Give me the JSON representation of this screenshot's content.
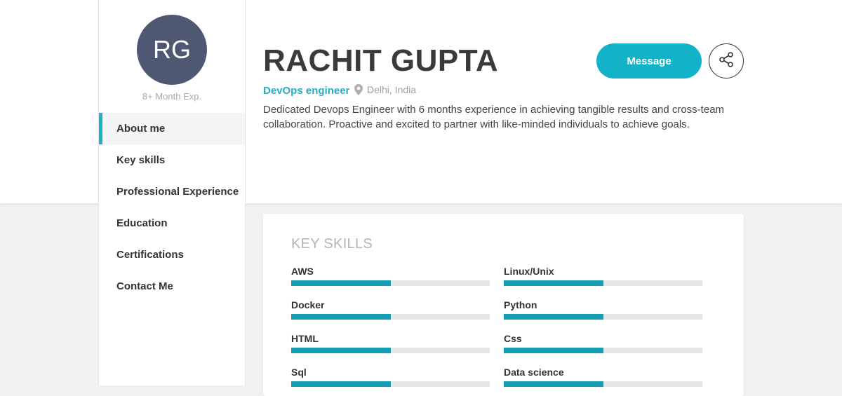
{
  "profile": {
    "initials": "RG",
    "experience": "8+ Month Exp.",
    "name": "RACHIT GUPTA",
    "role": "DevOps engineer",
    "location": "Delhi, India",
    "bio": "Dedicated Devops Engineer with 6 months experience in achieving tangible results and cross-team collaboration. Proactive and excited to partner with like-minded individuals to achieve goals."
  },
  "actions": {
    "message_label": "Message",
    "share_icon": "share-icon"
  },
  "nav": {
    "items": [
      {
        "label": "About me",
        "active": true
      },
      {
        "label": "Key skills",
        "active": false
      },
      {
        "label": "Professional Experience",
        "active": false
      },
      {
        "label": "Education",
        "active": false
      },
      {
        "label": "Certifications",
        "active": false
      },
      {
        "label": "Contact Me",
        "active": false
      }
    ]
  },
  "skills": {
    "title": "KEY SKILLS",
    "items": [
      {
        "label": "AWS",
        "level": 0.5
      },
      {
        "label": "Linux/Unix",
        "level": 0.5
      },
      {
        "label": "Docker",
        "level": 0.5
      },
      {
        "label": "Python",
        "level": 0.5
      },
      {
        "label": "HTML",
        "level": 0.5
      },
      {
        "label": "Css",
        "level": 0.5
      },
      {
        "label": "Sql",
        "level": 0.5
      },
      {
        "label": "Data science",
        "level": 0.5
      }
    ]
  },
  "colors": {
    "accent": "#12b3c9",
    "avatar_bg": "#4e5873",
    "bar_fill": "#139fb0"
  }
}
